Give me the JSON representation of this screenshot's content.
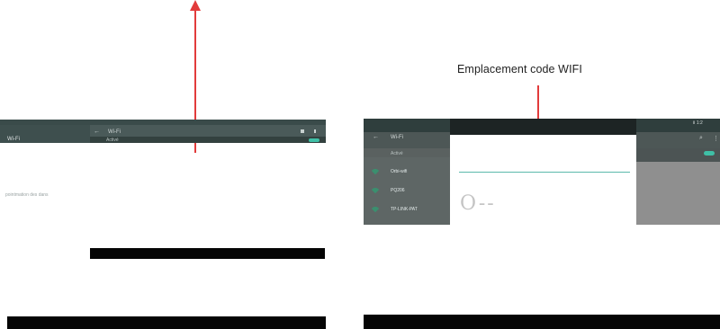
{
  "annotation": {
    "label": "Emplacement code WIFI"
  },
  "left_screen": {
    "title": "Wi-Fi",
    "subtitle": "Activé",
    "side_text": "Wi-Fi",
    "caption": "pointmation des dans"
  },
  "right_screen": {
    "title": "Wi-Fi",
    "subtitle": "Activé",
    "networks": [
      "Orbi-wifi",
      "PQ206",
      "TP-LINK-PAT"
    ],
    "password_glyphs": "O--",
    "status_text": "Ⅱ 1:2"
  },
  "colors": {
    "arrow": "#e23b3b",
    "toggle_accent": "#3fbfa6"
  },
  "icons": [
    "back-arrow-icon",
    "search-icon",
    "more-icon",
    "wifi-icon",
    "toggle-icon"
  ]
}
